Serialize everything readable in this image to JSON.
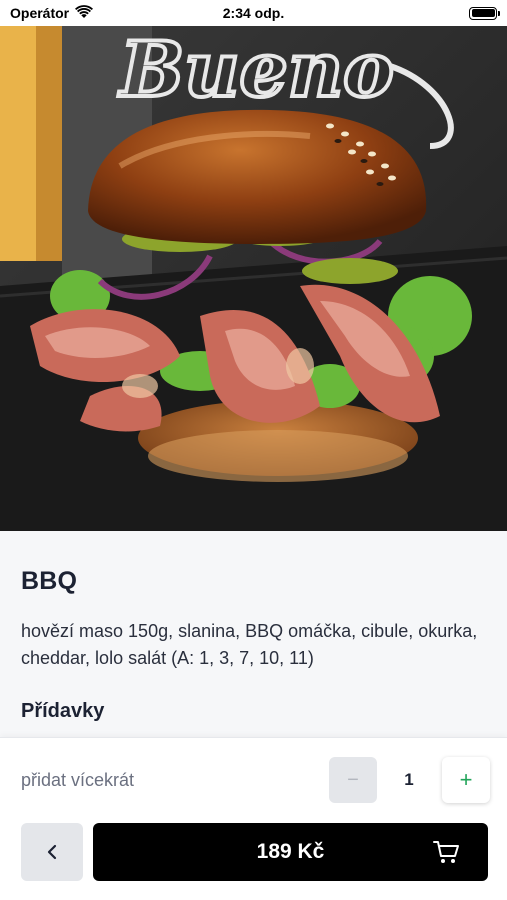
{
  "status_bar": {
    "carrier": "Operátor",
    "time": "2:34 odp.",
    "icons": [
      "wifi-icon",
      "battery-icon"
    ]
  },
  "hero": {
    "image_description": "burger photo",
    "background_text": "Bueno"
  },
  "product": {
    "title": "BBQ",
    "description": "hovězí maso 150g, slanina, BBQ omáčka, cibule, okurka, cheddar, lolo salát (A: 1, 3, 7, 10, 11)",
    "section_addons": "Přídavky"
  },
  "order": {
    "quantity_label": "přidat vícekrát",
    "minus_label": "−",
    "quantity": "1",
    "plus_label": "+",
    "price_label": "189 Kč"
  },
  "colors": {
    "accent_green": "#22a45a",
    "cart_button_bg": "#000000",
    "secondary_button_bg": "#e4e6ea",
    "text_primary": "#1c2233",
    "text_muted": "#6b7080"
  }
}
